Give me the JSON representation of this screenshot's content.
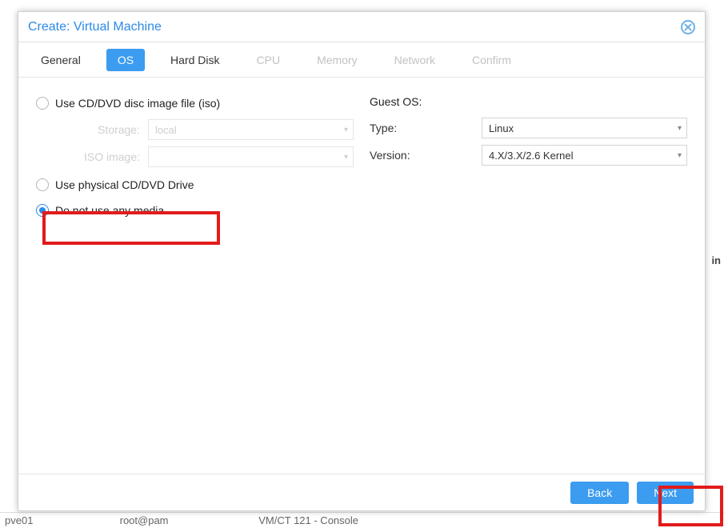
{
  "dialog": {
    "title": "Create: Virtual Machine"
  },
  "tabs": {
    "general": "General",
    "os": "OS",
    "hard_disk": "Hard Disk",
    "cpu": "CPU",
    "memory": "Memory",
    "network": "Network",
    "confirm": "Confirm"
  },
  "left": {
    "radio_iso": "Use CD/DVD disc image file (iso)",
    "storage_label": "Storage:",
    "storage_value": "local",
    "isoimage_label": "ISO image:",
    "isoimage_value": "",
    "radio_physical": "Use physical CD/DVD Drive",
    "radio_none": "Do not use any media"
  },
  "right": {
    "heading": "Guest OS:",
    "type_label": "Type:",
    "type_value": "Linux",
    "version_label": "Version:",
    "version_value": "4.X/3.X/2.6 Kernel"
  },
  "footer": {
    "back": "Back",
    "next": "Next"
  },
  "status": {
    "pve": "pve01",
    "user": "root@pam",
    "task": "VM/CT 121 - Console"
  },
  "bg_right": {
    "in": "in"
  }
}
